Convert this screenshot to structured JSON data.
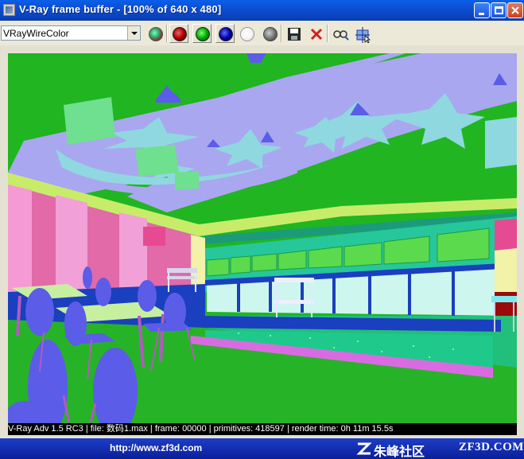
{
  "window": {
    "title": "V-Ray frame buffer - [100% of 640 x 480]",
    "controls": [
      "minimize",
      "maximize",
      "close"
    ]
  },
  "toolbar": {
    "channel_select": {
      "value": "VRayWireColor"
    },
    "buttons": [
      {
        "name": "rgb-channels-icon"
      },
      {
        "name": "red-channel-icon",
        "pressed": true
      },
      {
        "name": "green-channel-icon",
        "pressed": true
      },
      {
        "name": "blue-channel-icon",
        "pressed": true
      },
      {
        "name": "alpha-channel-icon"
      },
      {
        "name": "monochrome-icon"
      },
      {
        "name": "save-icon"
      },
      {
        "name": "clear-icon"
      },
      {
        "name": "track-mouse-icon"
      },
      {
        "name": "region-render-icon"
      }
    ]
  },
  "status": {
    "text": "V-Ray Adv 1.5 RC3 | file: 数码1.max | frame: 00000 | primitives: 418597 | render time: 0h 11m 15.5s"
  },
  "watermark": {
    "url": "http://www.zf3d.com",
    "name_cn": "朱峰社区",
    "site": "ZF3D.COM"
  },
  "colors": {
    "background_green": "#21b521",
    "ceiling_lavender": "#a9a7ef",
    "panel_teal": "#26c79a",
    "sign_green": "#5bda4d",
    "chair_blue": "#5b5ce8",
    "wall_pink": "#e26aa8",
    "floor_green": "#27b327"
  }
}
